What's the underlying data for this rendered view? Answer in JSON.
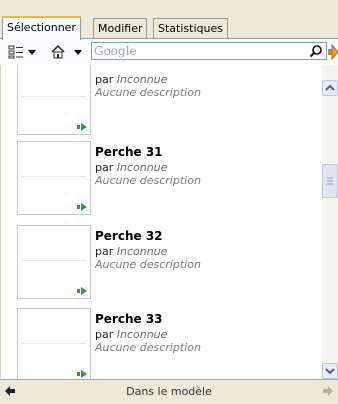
{
  "tabs": [
    {
      "label": "Sélectionner",
      "active": true
    },
    {
      "label": "Modifier",
      "active": false
    },
    {
      "label": "Statistiques",
      "active": false
    }
  ],
  "toolbar": {
    "view_icon": "list-view-icon",
    "home_icon": "home-icon",
    "search_placeholder": "Google",
    "search_value": "",
    "search_icon": "magnifier-icon",
    "go_icon": "arrow-right-icon"
  },
  "items": [
    {
      "title": "",
      "author_prefix": "par",
      "author": "Inconnue",
      "description": "Aucune description"
    },
    {
      "title": "Perche 31",
      "author_prefix": "par",
      "author": "Inconnue",
      "description": "Aucune description"
    },
    {
      "title": "Perche 32",
      "author_prefix": "par",
      "author": "Inconnue",
      "description": "Aucune description"
    },
    {
      "title": "Perche 33",
      "author_prefix": "par",
      "author": "Inconnue",
      "description": "Aucune description"
    }
  ],
  "bottom": {
    "label": "Dans le modèle",
    "back_icon": "arrow-left-icon",
    "forward_icon": "arrow-right-icon"
  },
  "colors": {
    "accent_tab": "#f5b14a",
    "badge_green": "#2e9b3a"
  }
}
